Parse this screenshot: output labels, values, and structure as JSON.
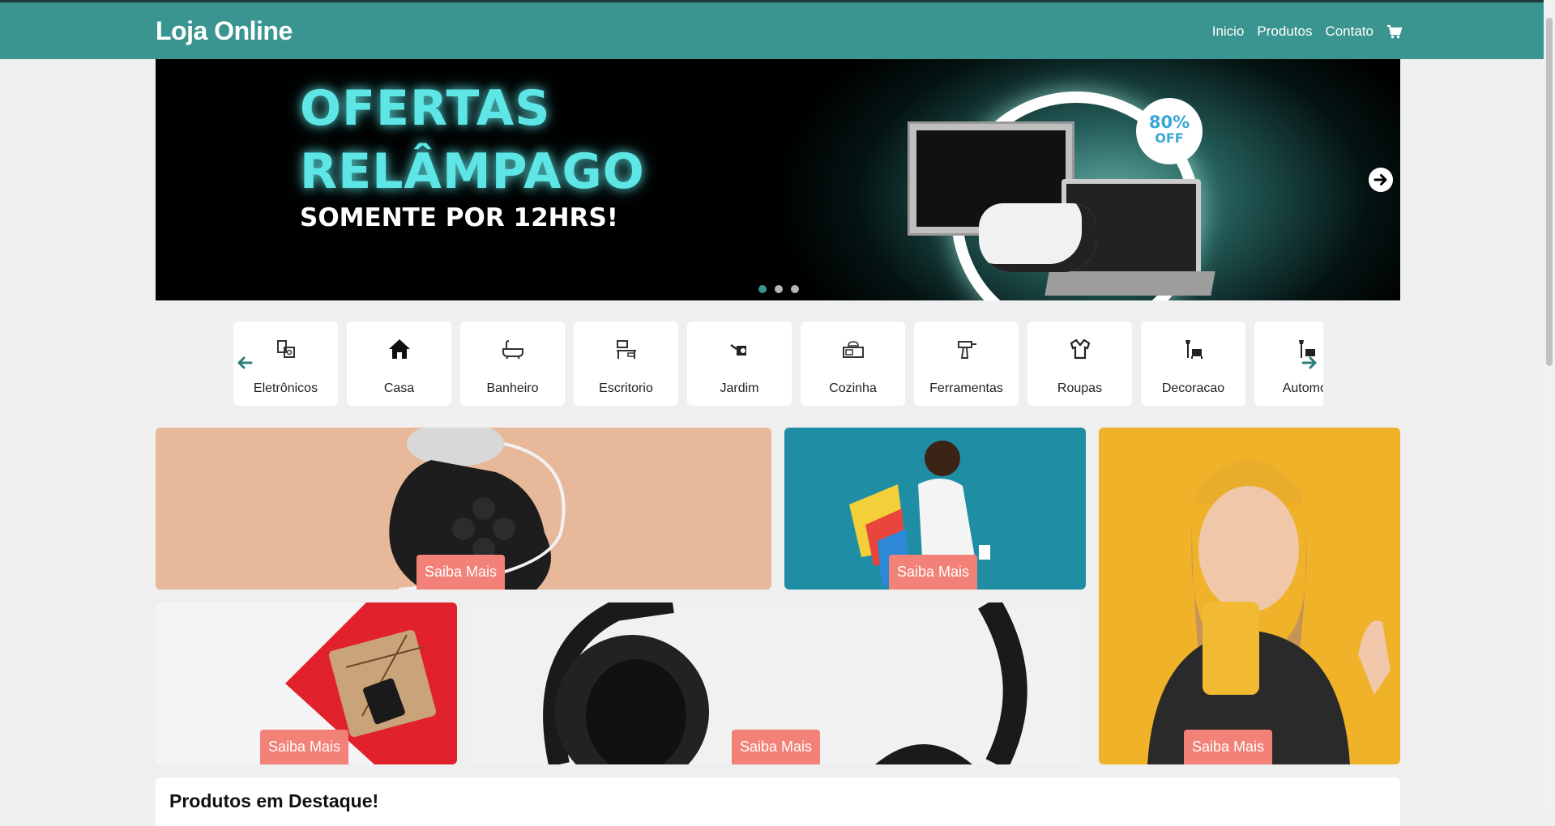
{
  "navbar": {
    "brand": "Loja Online",
    "links": [
      "Inicio",
      "Produtos",
      "Contato"
    ],
    "cart_icon": "cart-icon",
    "color": "#3a9490"
  },
  "hero": {
    "title_line1": "OFERTAS",
    "title_line2": "RELÂMPAGO",
    "subtitle": "SOMENTE POR 12HRS!",
    "badge_line1": "80%",
    "badge_line2": "OFF",
    "slides": 3,
    "active_slide": 1
  },
  "categories": [
    {
      "label": "Eletrônicos",
      "icon": "electronics-icon"
    },
    {
      "label": "Casa",
      "icon": "house-icon"
    },
    {
      "label": "Banheiro",
      "icon": "bathtub-icon"
    },
    {
      "label": "Escritorio",
      "icon": "office-desk-icon"
    },
    {
      "label": "Jardim",
      "icon": "watering-can-icon"
    },
    {
      "label": "Cozinha",
      "icon": "kitchen-icon"
    },
    {
      "label": "Ferramentas",
      "icon": "drill-icon"
    },
    {
      "label": "Roupas",
      "icon": "shirt-icon"
    },
    {
      "label": "Decoracao",
      "icon": "lamp-chair-icon"
    },
    {
      "label": "Automot",
      "icon": "car-icon"
    }
  ],
  "promo": {
    "button_label": "Saiba Mais",
    "button_color": "#f28178"
  },
  "featured": {
    "title": "Produtos em Destaque!"
  }
}
